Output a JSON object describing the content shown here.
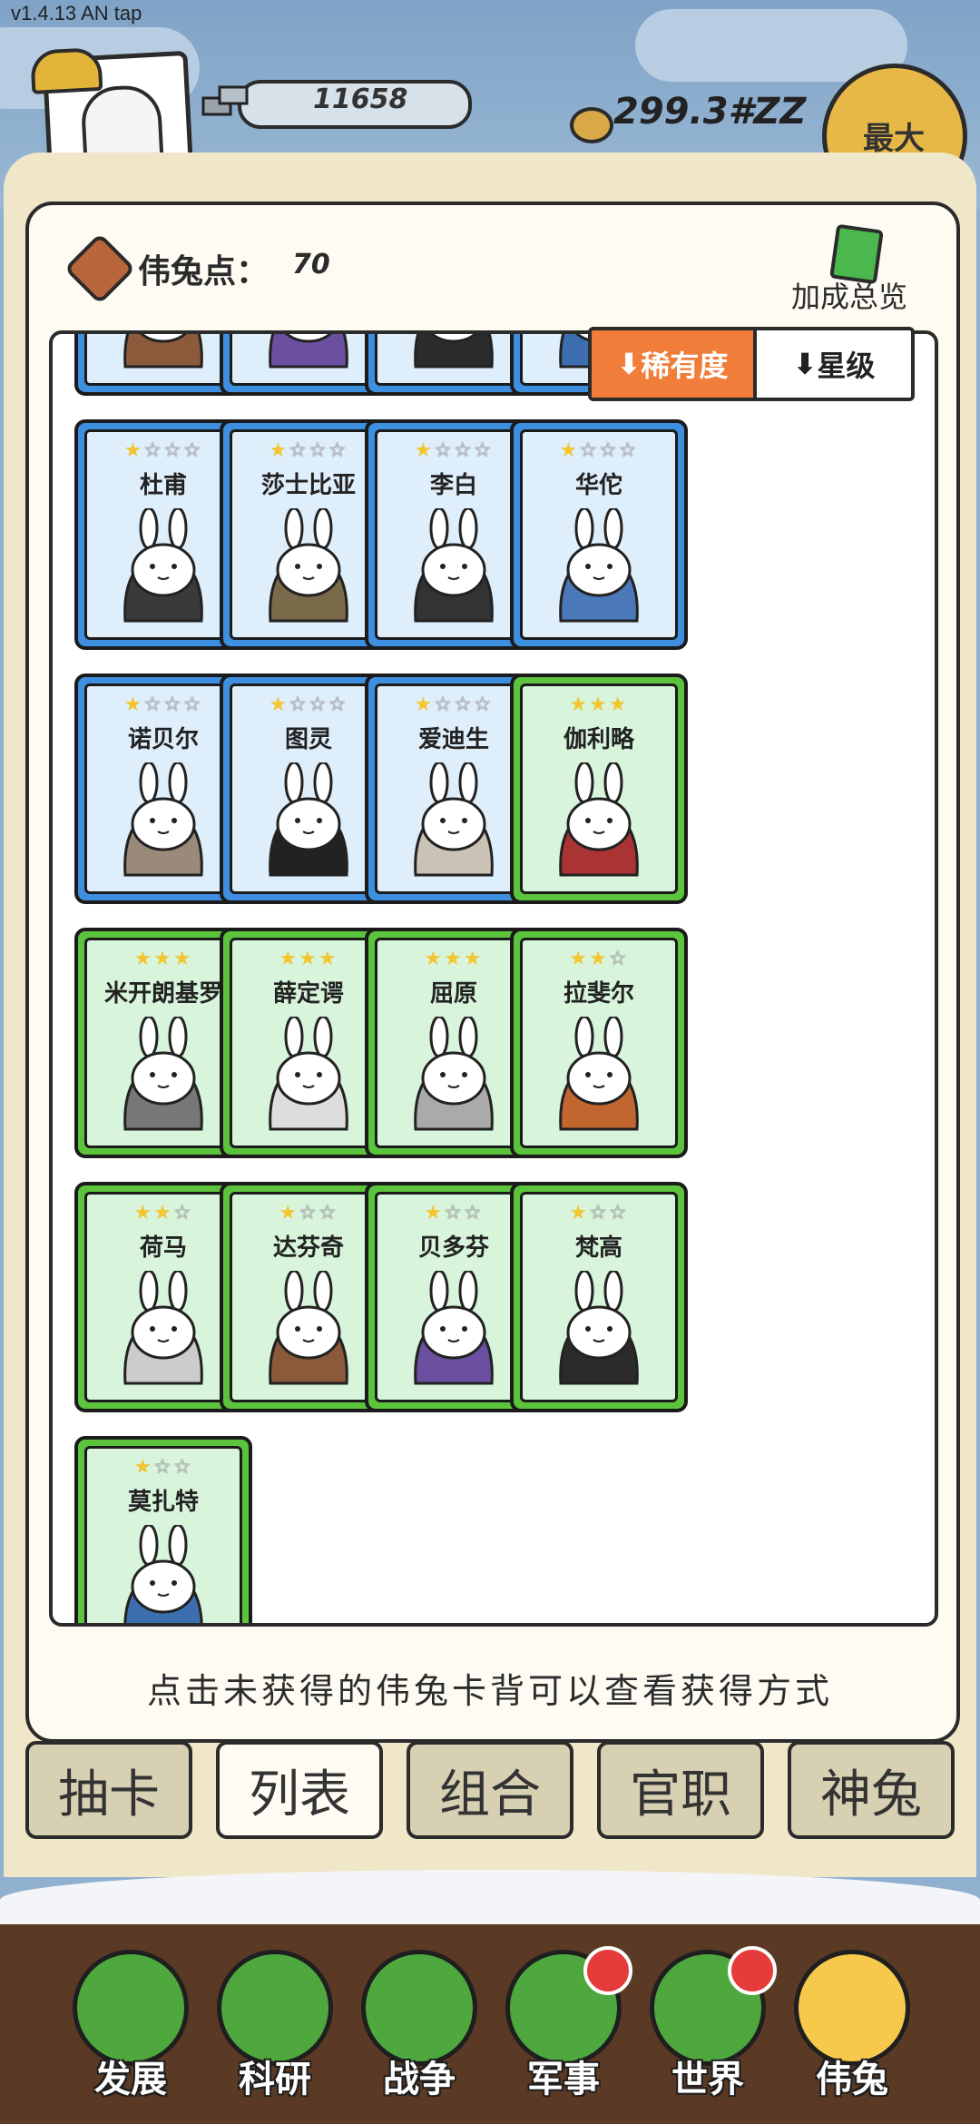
{
  "status": {
    "version": "v1.4.13 AN tap"
  },
  "hud": {
    "silver": "11658",
    "gold": "299.3#ZZ",
    "max_label": "最大"
  },
  "panel": {
    "points_label": "伟兔点：",
    "points_value": "70",
    "bonus_label": "加成总览"
  },
  "sort": {
    "rarity_label": "稀有度",
    "star_label": "星级",
    "arrow": "⬇"
  },
  "stars": {
    "on": "★",
    "off": "☆"
  },
  "cards": [
    {
      "name": "",
      "stars": 0,
      "max": 0,
      "rarity": "blue"
    },
    {
      "name": "",
      "stars": 0,
      "max": 0,
      "rarity": "blue"
    },
    {
      "name": "",
      "stars": 0,
      "max": 0,
      "rarity": "blue"
    },
    {
      "name": "",
      "stars": 0,
      "max": 0,
      "rarity": "blue"
    },
    {
      "name": "杜甫",
      "stars": 1,
      "max": 4,
      "rarity": "blue"
    },
    {
      "name": "莎士比亚",
      "stars": 1,
      "max": 4,
      "rarity": "blue"
    },
    {
      "name": "李白",
      "stars": 1,
      "max": 4,
      "rarity": "blue"
    },
    {
      "name": "华佗",
      "stars": 1,
      "max": 4,
      "rarity": "blue"
    },
    {
      "name": "诺贝尔",
      "stars": 1,
      "max": 4,
      "rarity": "blue"
    },
    {
      "name": "图灵",
      "stars": 1,
      "max": 4,
      "rarity": "blue"
    },
    {
      "name": "爱迪生",
      "stars": 1,
      "max": 4,
      "rarity": "blue"
    },
    {
      "name": "伽利略",
      "stars": 3,
      "max": 3,
      "rarity": "green"
    },
    {
      "name": "米开朗基罗",
      "stars": 3,
      "max": 3,
      "rarity": "green"
    },
    {
      "name": "薛定谔",
      "stars": 3,
      "max": 3,
      "rarity": "green"
    },
    {
      "name": "屈原",
      "stars": 3,
      "max": 3,
      "rarity": "green"
    },
    {
      "name": "拉斐尔",
      "stars": 2,
      "max": 3,
      "rarity": "green"
    },
    {
      "name": "荷马",
      "stars": 2,
      "max": 3,
      "rarity": "green"
    },
    {
      "name": "达芬奇",
      "stars": 1,
      "max": 3,
      "rarity": "green"
    },
    {
      "name": "贝多芬",
      "stars": 1,
      "max": 3,
      "rarity": "green"
    },
    {
      "name": "梵高",
      "stars": 1,
      "max": 3,
      "rarity": "green"
    },
    {
      "name": "莫扎特",
      "stars": 1,
      "max": 3,
      "rarity": "green"
    }
  ],
  "hint": "点击未获得的伟兔卡背可以查看获得方式",
  "tabs": [
    {
      "label": "抽卡",
      "active": false
    },
    {
      "label": "列表",
      "active": true
    },
    {
      "label": "组合",
      "active": false
    },
    {
      "label": "官职",
      "active": false
    },
    {
      "label": "神兔",
      "active": false
    }
  ],
  "nav": [
    {
      "label": "发展",
      "badge": false,
      "active": false,
      "icon": "axe-icon"
    },
    {
      "label": "科研",
      "badge": false,
      "active": false,
      "icon": "flask-icon"
    },
    {
      "label": "战争",
      "badge": false,
      "active": false,
      "icon": "swords-icon"
    },
    {
      "label": "军事",
      "badge": true,
      "active": false,
      "icon": "helmet-icon"
    },
    {
      "label": "世界",
      "badge": true,
      "active": false,
      "icon": "globe-icon"
    },
    {
      "label": "伟兔",
      "badge": false,
      "active": true,
      "icon": "bunny-portrait-icon"
    }
  ],
  "colors": {
    "rare_blue": "#3f8fe0",
    "common_green": "#5cc33d",
    "sort_active": "#f07d3a",
    "star": "#f2c531",
    "badge": "#e53b3b"
  }
}
